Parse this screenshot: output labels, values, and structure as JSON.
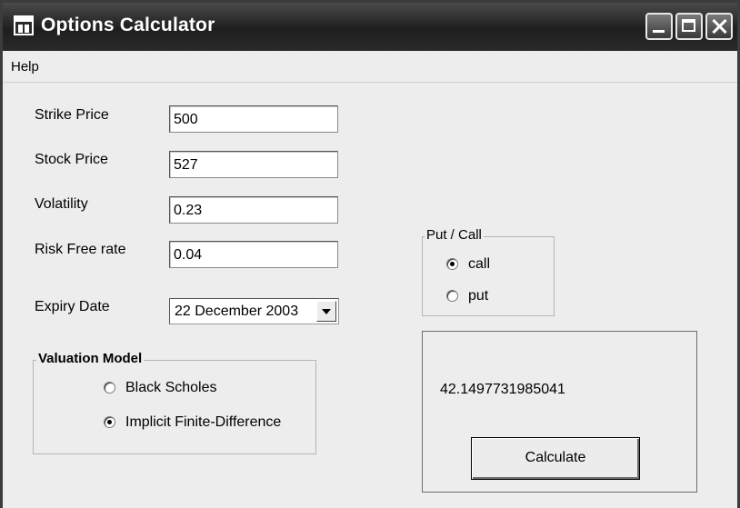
{
  "window": {
    "title": "Options Calculator"
  },
  "menu": {
    "help": "Help"
  },
  "fields": {
    "strike_price": {
      "label": "Strike Price",
      "value": "500"
    },
    "stock_price": {
      "label": "Stock Price",
      "value": "527"
    },
    "volatility": {
      "label": "Volatility",
      "value": "0.23"
    },
    "risk_free_rate": {
      "label": "Risk Free rate",
      "value": "0.04"
    },
    "expiry_date": {
      "label": "Expiry Date",
      "value": "22 December 2003"
    }
  },
  "valuation_model": {
    "title": "Valuation Model",
    "options": [
      {
        "label": "Black Scholes",
        "selected": false
      },
      {
        "label": "Implicit Finite-Difference",
        "selected": true
      }
    ]
  },
  "put_call": {
    "title": "Put / Call",
    "options": [
      {
        "label": "call",
        "selected": true
      },
      {
        "label": "put",
        "selected": false
      }
    ]
  },
  "result": {
    "value": "42.1497731985041"
  },
  "buttons": {
    "calculate": "Calculate"
  },
  "icons": {
    "app": "app-window-icon",
    "minimize": "minimize-icon",
    "maximize": "maximize-icon",
    "close": "close-icon"
  }
}
